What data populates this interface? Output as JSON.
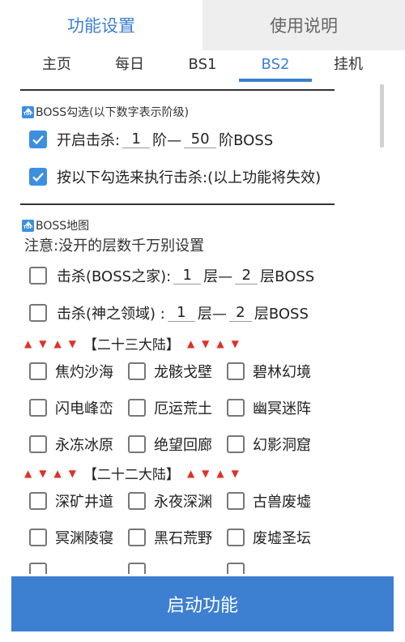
{
  "top_tabs": [
    "功能设置",
    "使用说明"
  ],
  "sub_tabs": [
    "主页",
    "每日",
    "BS1",
    "BS2",
    "挂机"
  ],
  "boss_select": {
    "header": "BOSS勾选(以下数字表示阶级)",
    "enable_kill": {
      "label_prefix": "开启击杀:",
      "from": "1",
      "sep": "阶—",
      "to": "50",
      "suffix": "阶BOSS",
      "checked": true
    },
    "use_checklist": {
      "label": "按以下勾选来执行击杀:(以上功能将失效)",
      "checked": true
    }
  },
  "boss_map": {
    "header": "BOSS地图",
    "note": "注意:没开的层数千万别设置",
    "home": {
      "label": "击杀(BOSS之家):",
      "from": "1",
      "sep": "层—",
      "to": "2",
      "suffix": "层BOSS",
      "checked": false
    },
    "divine": {
      "label": "击杀(神之领域) :",
      "from": "1",
      "sep": "层—",
      "to": "2",
      "suffix": "层BOSS",
      "checked": false
    }
  },
  "continents": [
    {
      "name": "【二十三大陆】",
      "areas": [
        [
          "焦灼沙海",
          "龙骸戈壁",
          "碧林幻境"
        ],
        [
          "闪电峰峦",
          "厄运荒土",
          "幽冥迷阵"
        ],
        [
          "永冻冰原",
          "绝望回廊",
          "幻影洞窟"
        ]
      ]
    },
    {
      "name": "【二十二大陆】",
      "areas": [
        [
          "深矿井道",
          "永夜深渊",
          "古兽废墟"
        ],
        [
          "冥渊陵寝",
          "黑石荒野",
          "废墟圣坛"
        ]
      ]
    }
  ],
  "launch_button": "启动功能"
}
